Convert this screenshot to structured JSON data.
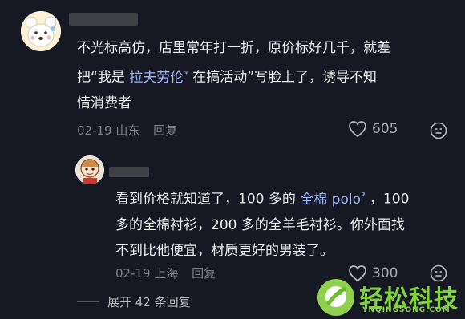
{
  "comment": {
    "text_line1": "不光标高仿，店里常年打一折，原价标好几千，就差",
    "text_line2_before": "把“我是 ",
    "text_line2_mention": "拉夫劳伦",
    "text_line2_after": " 在搞活动”写脸上了，诱导不知",
    "text_line3": "情消费者",
    "date": "02-19",
    "location": "山东",
    "reply_label": "回复",
    "like_count": "605"
  },
  "reply": {
    "text_line1_before": "看到价格就知道了，100 多的 ",
    "text_line1_mention": "全棉 polo",
    "text_line1_after": " ，100",
    "text_line2": "多的全棉衬衫，200 多的全羊毛衬衫。你外面找",
    "text_line3": "不到比他便宜，材质更好的男装了。",
    "date": "02-19",
    "location": "上海",
    "reply_label": "回复",
    "like_count": "300"
  },
  "expand_label": "展开 42 条回复",
  "watermark": {
    "title": "轻松科技",
    "url": "YNQINGSONG.COM"
  },
  "colors": {
    "background": "#161823",
    "mention": "#9db4ff",
    "watermark": "#7ed23b"
  },
  "icons": [
    "heart-icon",
    "emoji-icon",
    "search-icon"
  ]
}
